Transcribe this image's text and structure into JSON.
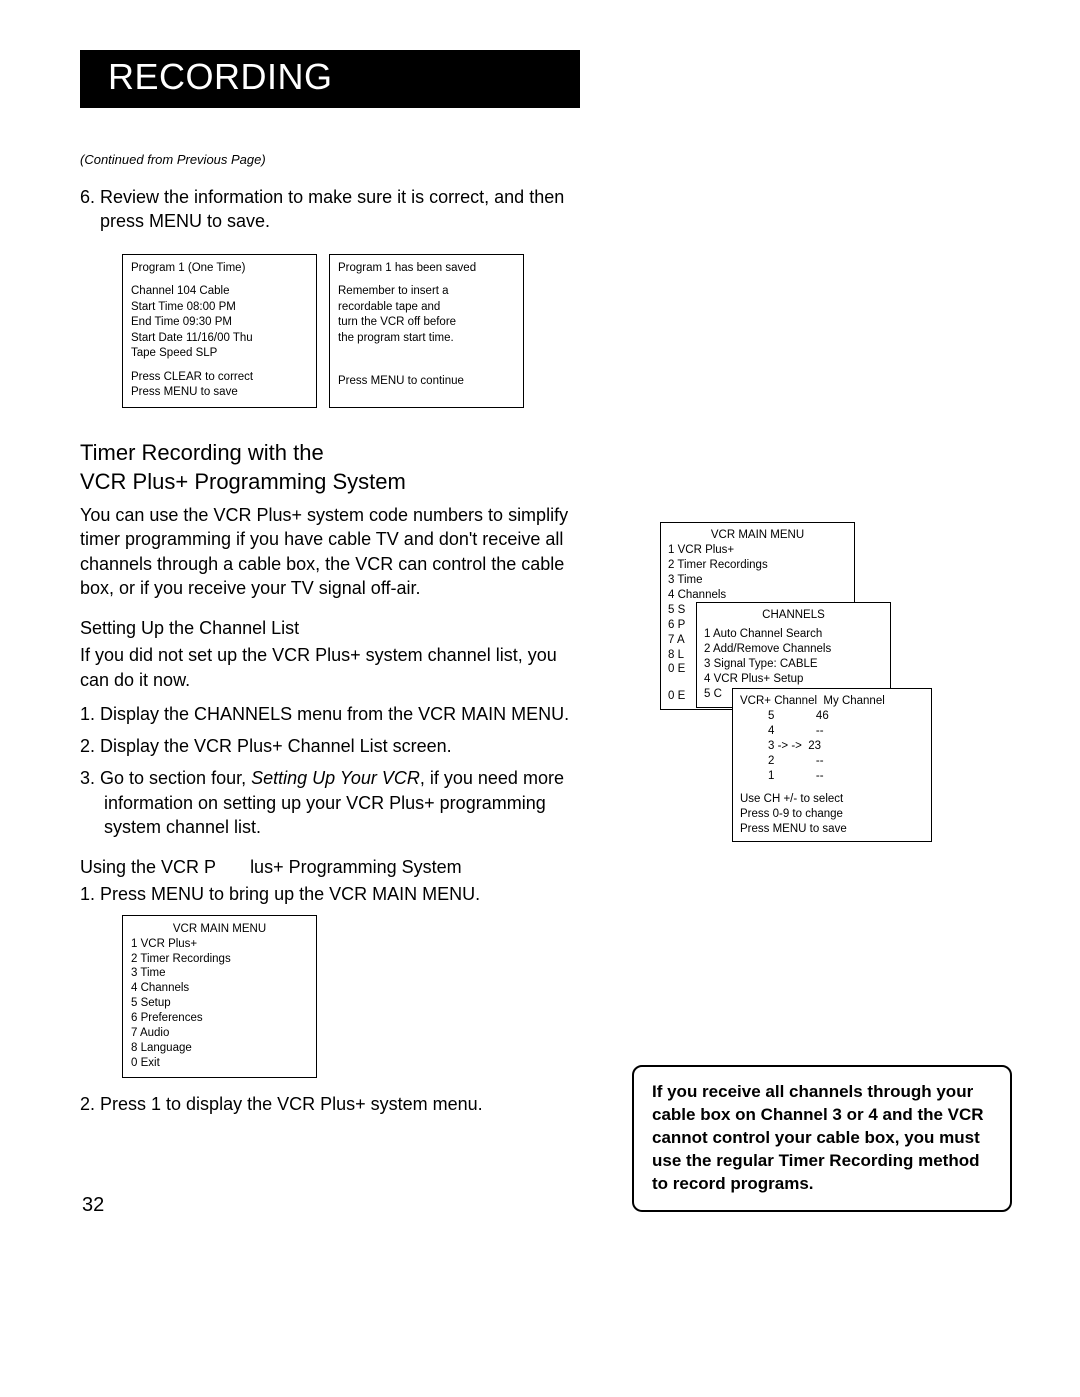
{
  "title": "RECORDING",
  "continued": "(Continued from Previous Page)",
  "step6": "6. Review the information to make sure it is correct, and then press MENU to save.",
  "boxA": {
    "l1": "Program 1 (One Time)",
    "l2": "Channel    104 Cable",
    "l3": "Start Time 08:00 PM",
    "l4": "End Time   09:30 PM",
    "l5": "Start Date 11/16/00 Thu",
    "l6": "Tape Speed SLP",
    "l7": "Press CLEAR to correct",
    "l8": "Press MENU to save"
  },
  "boxB": {
    "l1": "Program 1 has been saved",
    "l2": "Remember to insert a",
    "l3": "recordable tape and",
    "l4": "turn the VCR off before",
    "l5": "the program start time.",
    "l6": "Press MENU to continue"
  },
  "section_h_a": "Timer Recording with the",
  "section_h_b": "VCR Plus+ Programming System",
  "section_body": "You can use the VCR Plus+ system code numbers to simplify timer programming if you have cable TV and don't receive all channels through a cable box, the VCR can control the cable box, or if you receive your TV signal off-air.",
  "subh1": "Setting Up the Channel List",
  "sub1_body": "If you did not set up the VCR Plus+ system channel list, you can do it now.",
  "sub1_s1": "1.  Display the CHANNELS menu from the VCR MAIN MENU.",
  "sub1_s2": "2.  Display the VCR Plus+ Channel List screen.",
  "sub1_s3_a": "3.  Go to section four, ",
  "sub1_s3_italic": "Setting Up Your VCR",
  "sub1_s3_b": ", if you need more information on setting up your VCR Plus+ programming system channel list.",
  "subh2_a": "Using the VCR P",
  "subh2_b": "lus+ Programming System",
  "sub2_s1": "1.  Press MENU to bring up the VCR MAIN MENU.",
  "menu": {
    "title": "VCR MAIN MENU",
    "m1": "1 VCR Plus+",
    "m2": "2 Timer Recordings",
    "m3": "3 Time",
    "m4": "4 Channels",
    "m5": "5 Setup",
    "m6": "6 Preferences",
    "m7": "7 Audio",
    "m8": "8 Language",
    "m0": "0 Exit"
  },
  "sub2_s2": "2.  Press 1 to display  the VCR Plus+ system menu.",
  "rs1": {
    "title": "VCR MAIN MENU",
    "r1": "1 VCR Plus+",
    "r2": "2 Timer Recordings",
    "r3": "3 Time",
    "r4": "4 Channels",
    "r5": "5 S",
    "r6": "6 P",
    "r7": "7 A",
    "r8": "8 L",
    "r9": "0 E",
    "r10": "0 E"
  },
  "rs2": {
    "title": "CHANNELS",
    "c1": "1 Auto Channel Search",
    "c2": "2 Add/Remove Channels",
    "c3": "3 Signal Type:   CABLE",
    "c4": "4 VCR Plus+ Setup",
    "c5": "5 C"
  },
  "rs3": {
    "hdr": "VCR+ Channel  My Channel",
    "r1": "5             46",
    "r2": "4             --",
    "r3": "3 -> ->  23",
    "r4": "2             --",
    "r5": "1             --",
    "f1": "Use CH +/- to select",
    "f2": "Press 0-9 to change",
    "f3": "Press MENU to save"
  },
  "note": "If you receive all channels through your cable box on Channel 3 or 4 and the VCR cannot control your cable box, you must use the regular Timer Recording method to record programs.",
  "page_number": "32"
}
